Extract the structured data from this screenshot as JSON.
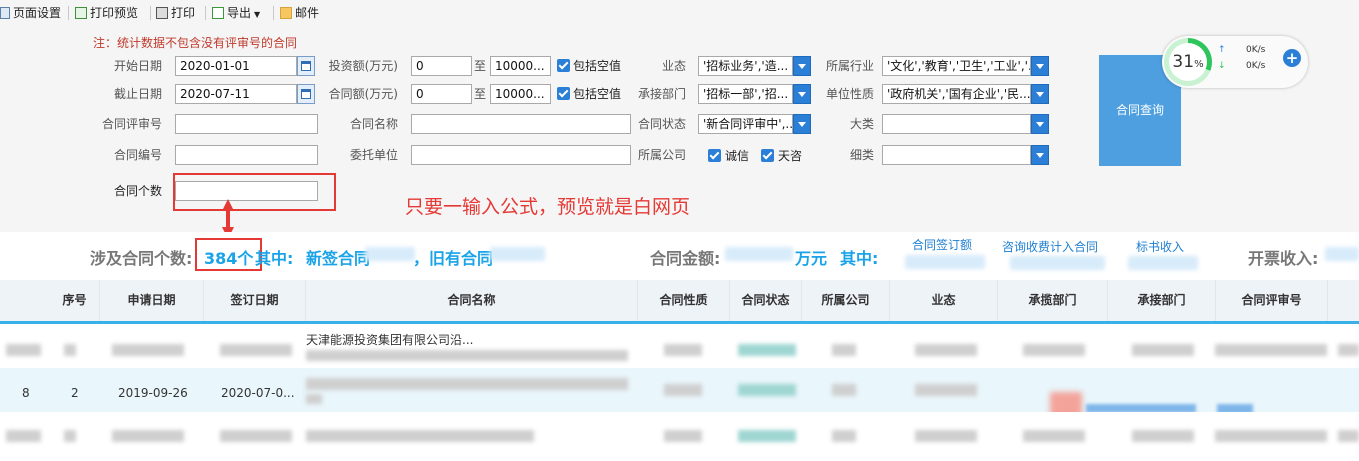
{
  "toolbar": {
    "page_setup": "页面设置",
    "print_preview": "打印预览",
    "print": "打印",
    "export": "导出",
    "mail": "邮件"
  },
  "filter": {
    "note": "注：统计数据不包含没有评审号的合同",
    "start_date_label": "开始日期",
    "start_date": "2020-01-01",
    "end_date_label": "截止日期",
    "end_date": "2020-07-11",
    "investment_label": "投资额(万元)",
    "investment_from": "0",
    "investment_to": "10000...",
    "contract_amount_label": "合同额(万元)",
    "contract_amount_from": "0",
    "contract_amount_to": "10000...",
    "to_label": "至",
    "include_empty": "包括空值",
    "business_label": "业态",
    "business_value": "'招标业务','造...",
    "industry_label": "所属行业",
    "industry_value": "'文化','教育','卫生','工业','...",
    "dept_label": "承接部门",
    "dept_value": "'招标一部','招...",
    "unit_nature_label": "单位性质",
    "unit_nature_value": "'政府机关','国有企业','民...",
    "review_no_label": "合同评审号",
    "contract_name_label": "合同名称",
    "status_label": "合同状态",
    "status_value": "'新合同评审中',...",
    "category_label": "大类",
    "contract_no_label": "合同编号",
    "client_unit_label": "委托单位",
    "company_label": "所属公司",
    "company_option_1": "诚信",
    "company_option_2": "天咨",
    "subcategory_label": "细类",
    "count_label": "合同个数",
    "query_button": "合同查询"
  },
  "widget": {
    "percent": "31",
    "percent_unit": "%",
    "up_speed": "0K/s",
    "down_speed": "0K/s",
    "percent_fraction": 0.31
  },
  "annotation": {
    "text": "只要一输入公式，预览就是白网页"
  },
  "summary": {
    "count_label": "涉及合同个数:",
    "count_value": "384个",
    "among": "其中:",
    "new_contract": "新签合同",
    "old_contract": "，旧有合同",
    "amount_label": "合同金额:",
    "amount_unit": "万元",
    "among2": "其中:",
    "link_1": "合同签订额",
    "link_2": "咨询收费计入合同",
    "link_3": "标书收入",
    "invoice_label": "开票收入:"
  },
  "table": {
    "headers": [
      "序号",
      "申请日期",
      "签订日期",
      "合同名称",
      "合同性质",
      "合同状态",
      "所属公司",
      "业态",
      "承揽部门",
      "承接部门",
      "合同评审号"
    ],
    "rows": [
      {
        "name_prefix": "天津能源投资集团有限公司沿..."
      },
      {
        "col0": "8",
        "seq": "2",
        "apply_date": "2019-09-26",
        "sign_date": "2020-07-0..."
      },
      {}
    ]
  }
}
